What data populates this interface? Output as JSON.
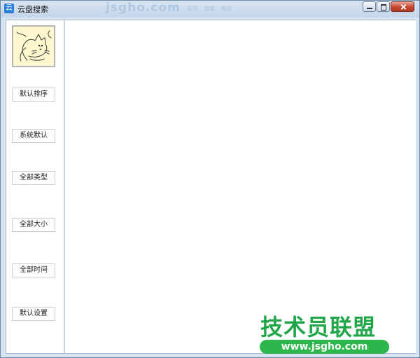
{
  "window": {
    "title": "云盘搜索",
    "app_icon_glyph": "云",
    "app_icon": "cloud-app-icon",
    "background_logo": "jsgho.com",
    "background_links": "首页 搜索 帮助"
  },
  "sidebar": {
    "avatar": "kitten-sketch-image",
    "buttons": [
      {
        "label": "默认排序"
      },
      {
        "label": "系统默认"
      },
      {
        "label": "全部类型"
      },
      {
        "label": "全部大小"
      },
      {
        "label": "全部时间"
      },
      {
        "label": "默认设置"
      }
    ]
  },
  "watermark": {
    "title": "技术员联盟",
    "url": "www.jsgho.com"
  },
  "colors": {
    "accent_green": "#22a64a",
    "frame_blue": "#b9d1ea",
    "close_red": "#c6452e"
  }
}
